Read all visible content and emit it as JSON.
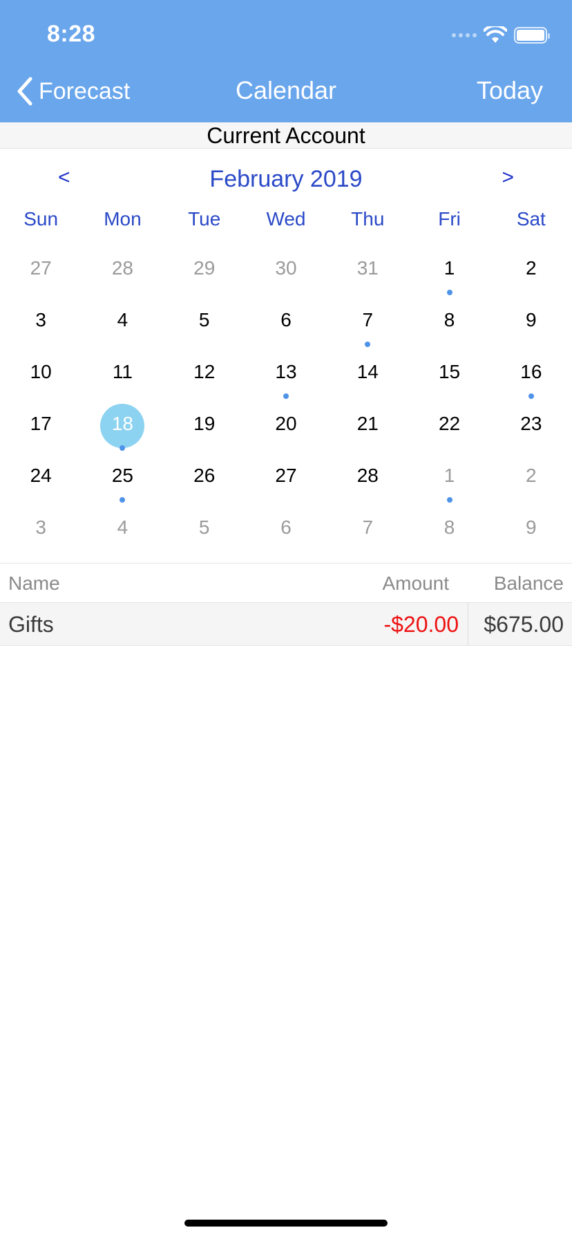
{
  "status": {
    "time": "8:28"
  },
  "nav": {
    "back_label": "Forecast",
    "title": "Calendar",
    "today_label": "Today"
  },
  "account": {
    "name": "Current Account"
  },
  "calendar": {
    "prev": "<",
    "next": ">",
    "month_title": "February 2019",
    "weekdays": [
      "Sun",
      "Mon",
      "Tue",
      "Wed",
      "Thu",
      "Fri",
      "Sat"
    ],
    "selected": {
      "week": 3,
      "day": 1
    },
    "weeks": [
      [
        {
          "n": "27",
          "other": true
        },
        {
          "n": "28",
          "other": true
        },
        {
          "n": "29",
          "other": true
        },
        {
          "n": "30",
          "other": true
        },
        {
          "n": "31",
          "other": true
        },
        {
          "n": "1",
          "dot": true
        },
        {
          "n": "2"
        }
      ],
      [
        {
          "n": "3"
        },
        {
          "n": "4"
        },
        {
          "n": "5"
        },
        {
          "n": "6"
        },
        {
          "n": "7",
          "dot": true
        },
        {
          "n": "8"
        },
        {
          "n": "9"
        }
      ],
      [
        {
          "n": "10"
        },
        {
          "n": "11"
        },
        {
          "n": "12"
        },
        {
          "n": "13",
          "dot": true
        },
        {
          "n": "14"
        },
        {
          "n": "15"
        },
        {
          "n": "16",
          "dot": true
        }
      ],
      [
        {
          "n": "17"
        },
        {
          "n": "18",
          "dot": true,
          "selected": true
        },
        {
          "n": "19"
        },
        {
          "n": "20"
        },
        {
          "n": "21"
        },
        {
          "n": "22"
        },
        {
          "n": "23"
        }
      ],
      [
        {
          "n": "24"
        },
        {
          "n": "25",
          "dot": true
        },
        {
          "n": "26"
        },
        {
          "n": "27"
        },
        {
          "n": "28"
        },
        {
          "n": "1",
          "other": true,
          "dot": true
        },
        {
          "n": "2",
          "other": true
        }
      ],
      [
        {
          "n": "3",
          "other": true
        },
        {
          "n": "4",
          "other": true
        },
        {
          "n": "5",
          "other": true
        },
        {
          "n": "6",
          "other": true
        },
        {
          "n": "7",
          "other": true
        },
        {
          "n": "8",
          "other": true
        },
        {
          "n": "9",
          "other": true
        }
      ]
    ]
  },
  "table": {
    "headers": {
      "name": "Name",
      "amount": "Amount",
      "balance": "Balance"
    },
    "rows": [
      {
        "name": "Gifts",
        "amount": "-$20.00",
        "balance": "$675.00"
      }
    ]
  },
  "colors": {
    "header_bg": "#6aa6ec",
    "calendar_accent": "#2a49c7",
    "event_dot": "#4f93e8",
    "selected_circle": "#8cd3f1",
    "negative_amount": "#ee1111"
  }
}
